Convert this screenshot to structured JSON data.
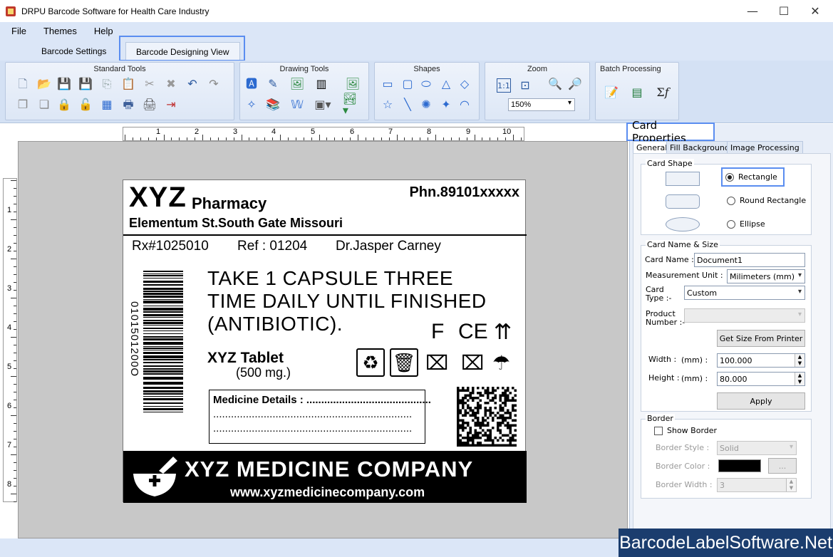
{
  "window": {
    "title": "DRPU Barcode Software for Health Care Industry",
    "minimize": "—",
    "maximize": "☐",
    "close": "✕"
  },
  "menu": [
    "File",
    "Themes",
    "Help"
  ],
  "ribbon_tabs": [
    "Barcode Settings",
    "Barcode Designing View"
  ],
  "ribbon": {
    "groups": [
      "Standard Tools",
      "Drawing Tools",
      "Shapes",
      "Zoom",
      "Batch Processing"
    ],
    "zoom_value": "150%"
  },
  "rulers": {
    "horizontal": [
      "1",
      "2",
      "3",
      "4",
      "5",
      "6",
      "7",
      "8",
      "9",
      "10"
    ],
    "vertical": [
      "1",
      "2",
      "3",
      "4",
      "5",
      "6",
      "7",
      "8"
    ]
  },
  "label": {
    "brand": "XYZ",
    "brand_suffix": "Pharmacy",
    "phone": "Phn.89101xxxxx",
    "address": "Elementum St.South Gate Missouri",
    "rx": "Rx#1025010",
    "ref": "Ref : 01204",
    "doctor": "Dr.Jasper Carney",
    "barcode_number": "0101501200O",
    "instructions": [
      "TAKE 1 CAPSULE THREE",
      "TIME DAILY UNTIL FINISHED",
      "(ANTIBIOTIC)."
    ],
    "symbols": [
      "F",
      "CE",
      "⇈"
    ],
    "tablet_name": "XYZ Tablet",
    "tablet_dose": "(500 mg.)",
    "medicine_details_label": "Medicine Details : ..........................................",
    "medicine_details_line2": "...................................................................",
    "medicine_details_line3": "...................................................................",
    "company_name": "XYZ MEDICINE COMPANY",
    "company_url": "www.xyzmedicinecompany.com"
  },
  "panel": {
    "title": "Card Properties",
    "tabs": [
      "General",
      "Fill Background",
      "Image Processing"
    ],
    "card_shape": {
      "legend": "Card Shape",
      "options": [
        "Rectangle",
        "Round Rectangle",
        "Ellipse"
      ],
      "selected": "Rectangle"
    },
    "card_name_size": {
      "legend": "Card  Name & Size",
      "card_name_label": "Card Name :",
      "card_name_value": "Document1",
      "measurement_label": "Measurement Unit :",
      "measurement_value": "Milimeters (mm)",
      "card_type_label": "Card\nType :-",
      "card_type_value": "Custom",
      "product_number_label": "Product\nNumber :-",
      "product_number_value": "",
      "get_size_button": "Get Size From Printer",
      "width_label": "Width :",
      "width_unit": "(mm) :",
      "width_value": "100.000",
      "height_label": "Height :",
      "height_unit": "(mm) :",
      "height_value": "80.000",
      "apply_button": "Apply"
    },
    "border": {
      "legend": "Border",
      "show_border_label": "Show Border",
      "style_label": "Border Style :",
      "style_value": "Solid",
      "color_label": "Border Color :",
      "color_value": "#000000",
      "color_button": "...",
      "width_label": "Border Width :",
      "width_value": "3"
    }
  },
  "watermark": "BarcodeLabelSoftware.Net"
}
